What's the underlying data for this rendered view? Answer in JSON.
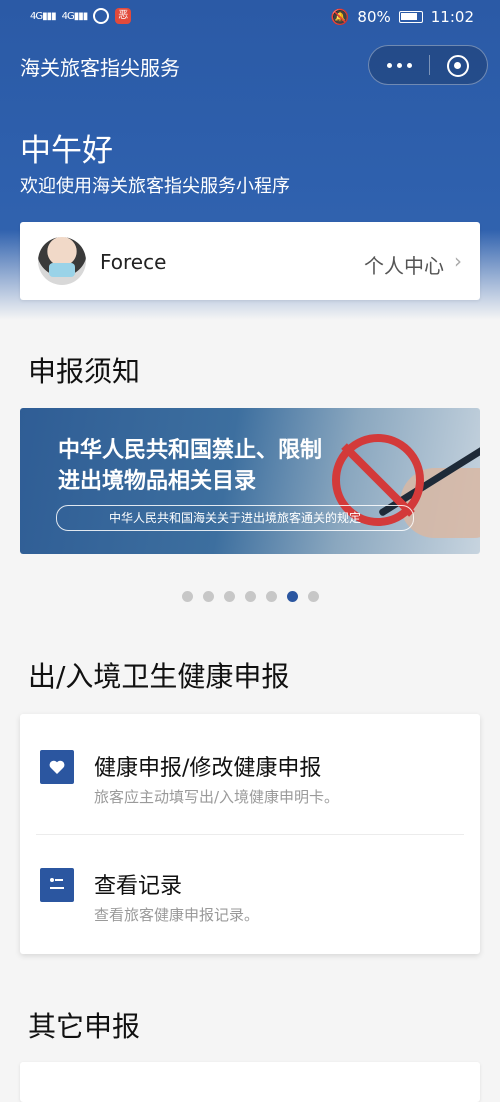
{
  "status_bar": {
    "signal1": "4G",
    "signal2": "4G",
    "app_badge": "恶",
    "battery": "80%",
    "time": "11:02"
  },
  "nav": {
    "title": "海关旅客指尖服务"
  },
  "hero": {
    "greeting": "中午好",
    "welcome": "欢迎使用海关旅客指尖服务小程序"
  },
  "profile": {
    "username": "Forece",
    "center_link": "个人中心"
  },
  "notice": {
    "section_title": "申报须知",
    "banner_line1": "中华人民共和国禁止、限制",
    "banner_line2": "进出境物品相关目录",
    "banner_sub": "中华人民共和国海关关于进出境旅客通关的规定",
    "slide_count": 7,
    "active_slide": 6
  },
  "health": {
    "section_title": "出/入境卫生健康申报",
    "items": [
      {
        "title": "健康申报/修改健康申报",
        "subtitle": "旅客应主动填写出/入境健康申明卡。",
        "icon": "heart-icon"
      },
      {
        "title": "查看记录",
        "subtitle": "查看旅客健康申报记录。",
        "icon": "records-icon"
      }
    ]
  },
  "other": {
    "section_title": "其它申报"
  },
  "colors": {
    "primary": "#2b56a0",
    "header": "#2e60ad"
  }
}
